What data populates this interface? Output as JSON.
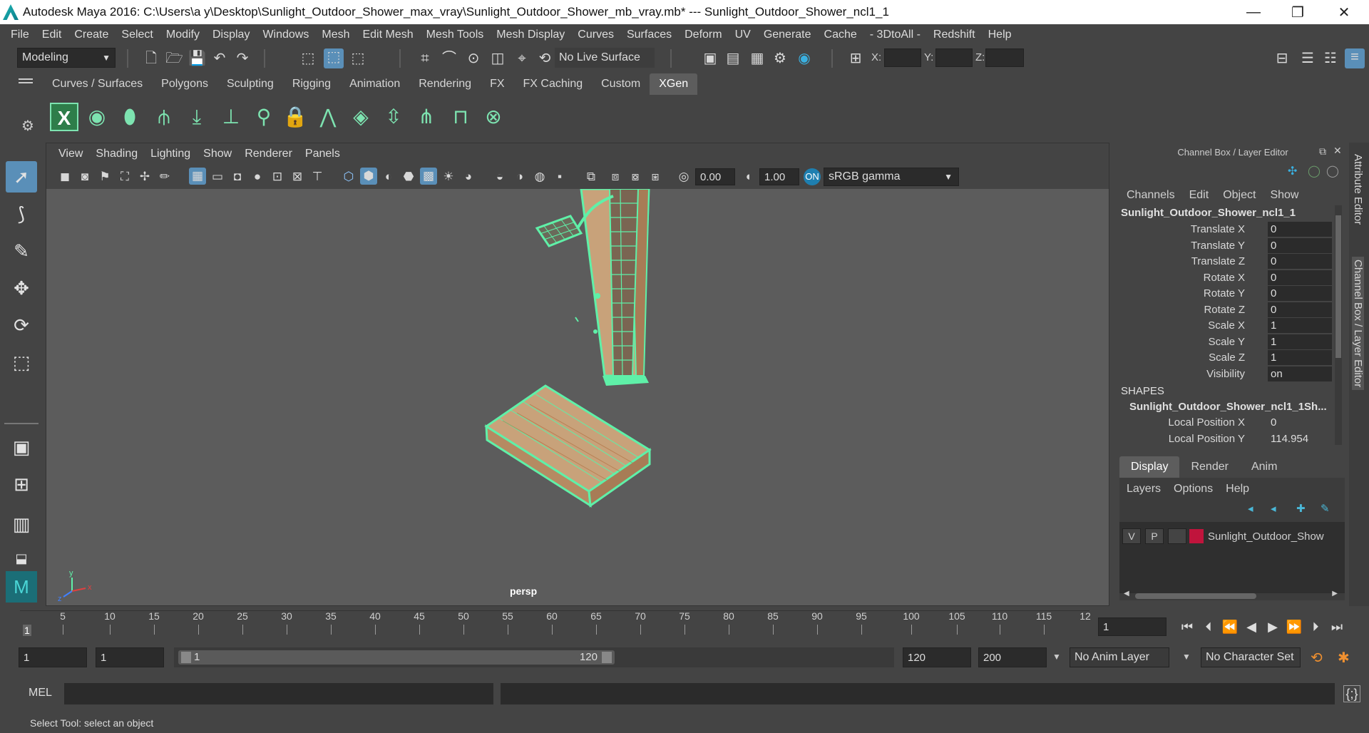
{
  "titlebar": {
    "title": "Autodesk Maya 2016: C:\\Users\\a y\\Desktop\\Sunlight_Outdoor_Shower_max_vray\\Sunlight_Outdoor_Shower_mb_vray.mb*  ---  Sunlight_Outdoor_Shower_ncl1_1",
    "minimize": "—",
    "maximize": "❐",
    "close": "✕"
  },
  "menubar": [
    "File",
    "Edit",
    "Create",
    "Select",
    "Modify",
    "Display",
    "Windows",
    "Mesh",
    "Edit Mesh",
    "Mesh Tools",
    "Mesh Display",
    "Curves",
    "Surfaces",
    "Deform",
    "UV",
    "Generate",
    "Cache",
    "- 3DtoAll -",
    "Redshift",
    "Help"
  ],
  "statusline": {
    "mode": "Modeling",
    "live_surface": "No Live Surface",
    "x_label": "X:",
    "y_label": "Y:",
    "z_label": "Z:"
  },
  "shelf": {
    "tabs": [
      "Curves / Surfaces",
      "Polygons",
      "Sculpting",
      "Rigging",
      "Animation",
      "Rendering",
      "FX",
      "FX Caching",
      "Custom",
      "XGen"
    ],
    "active_tab": "XGen"
  },
  "viewport": {
    "menu": [
      "View",
      "Shading",
      "Lighting",
      "Show",
      "Renderer",
      "Panels"
    ],
    "exposure": "0.00",
    "gamma": "1.00",
    "color_space": "sRGB gamma",
    "camera_label": "persp"
  },
  "channelbox": {
    "title": "Channel Box / Layer Editor",
    "menu": [
      "Channels",
      "Edit",
      "Object",
      "Show"
    ],
    "object_name": "Sunlight_Outdoor_Shower_ncl1_1",
    "attributes": [
      {
        "label": "Translate X",
        "value": "0"
      },
      {
        "label": "Translate Y",
        "value": "0"
      },
      {
        "label": "Translate Z",
        "value": "0"
      },
      {
        "label": "Rotate X",
        "value": "0"
      },
      {
        "label": "Rotate Y",
        "value": "0"
      },
      {
        "label": "Rotate Z",
        "value": "0"
      },
      {
        "label": "Scale X",
        "value": "1"
      },
      {
        "label": "Scale Y",
        "value": "1"
      },
      {
        "label": "Scale Z",
        "value": "1"
      },
      {
        "label": "Visibility",
        "value": "on"
      }
    ],
    "shapes_header": "SHAPES",
    "shape_name": "Sunlight_Outdoor_Shower_ncl1_1Sh...",
    "shape_attributes": [
      {
        "label": "Local Position X",
        "value": "0"
      },
      {
        "label": "Local Position Y",
        "value": "114.954"
      }
    ],
    "layer_tabs": [
      "Display",
      "Render",
      "Anim"
    ],
    "layer_menu": [
      "Layers",
      "Options",
      "Help"
    ],
    "layer": {
      "v": "V",
      "p": "P",
      "name": "Sunlight_Outdoor_Show",
      "color": "#c0143c"
    },
    "side_tabs": [
      "Attribute Editor",
      "Channel Box / Layer Editor"
    ]
  },
  "timeslider": {
    "ticks": [
      "5",
      "10",
      "15",
      "20",
      "25",
      "30",
      "35",
      "40",
      "45",
      "50",
      "55",
      "60",
      "65",
      "70",
      "75",
      "80",
      "85",
      "90",
      "95",
      "100",
      "105",
      "110",
      "115",
      "12"
    ],
    "start_frame": "1",
    "current_frame": "1"
  },
  "rangeslider": {
    "start": "1",
    "playback_start": "1",
    "slider_start": "1",
    "slider_end": "120",
    "playback_end": "120",
    "end": "200",
    "anim_layer": "No Anim Layer",
    "character_set": "No Character Set"
  },
  "cmdline": {
    "label": "MEL"
  },
  "helpline": {
    "text": "Select Tool: select an object"
  },
  "colors": {
    "accent_green": "#7de3b0",
    "wire": "#5ff0a8",
    "wood": "#c8a27a",
    "layer_red": "#c0143c",
    "viewport_bg": "#5c5c5c"
  }
}
